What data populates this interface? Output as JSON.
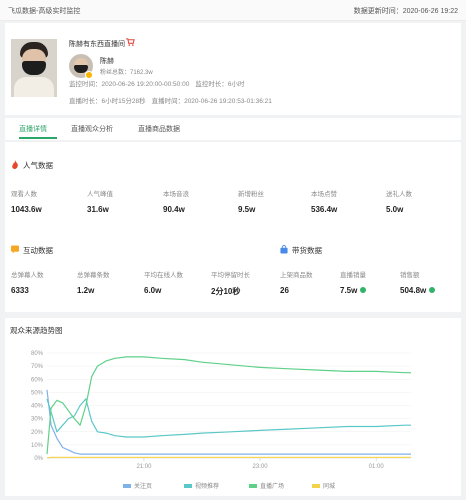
{
  "topbar": {
    "title": "飞瓜数据-高级实时监控",
    "update_time": "数据更新时间：2020-06-26 19:22"
  },
  "profile": {
    "room_title": "陈赫有东西直播间",
    "anchor_name": "陈赫",
    "fans": "粉丝总数：7162.3w",
    "monitor_time_label": "监控时间：",
    "monitor_time": "2020-06-26 19:20:00-00:50:00",
    "monitor_duration": "监控时长：6小时",
    "live_time_label": "直播时长：",
    "live_duration": "6小时15分28秒",
    "live_time_label2": "直播时间：",
    "live_time": "2020-06-26 19:20:53-01:36:21"
  },
  "tabs": [
    {
      "label": "直播详情",
      "active": true
    },
    {
      "label": "直播观众分析",
      "active": false
    },
    {
      "label": "直播商品数据",
      "active": false
    }
  ],
  "popularity": {
    "title": "人气数据",
    "icon": "fire-icon",
    "items": [
      {
        "label": "观看人数",
        "value": "1043.6w"
      },
      {
        "label": "人气峰值",
        "value": "31.6w"
      },
      {
        "label": "本场音浪",
        "value": "90.4w"
      },
      {
        "label": "新增粉丝",
        "value": "9.5w"
      },
      {
        "label": "本场点赞",
        "value": "536.4w"
      },
      {
        "label": "送礼人数",
        "value": "5.0w"
      }
    ]
  },
  "interaction": {
    "title": "互动数据",
    "icon": "chat-icon",
    "items": [
      {
        "label": "总弹幕人数",
        "value": "6333"
      },
      {
        "label": "总弹幕条数",
        "value": "1.2w"
      },
      {
        "label": "平均在线人数",
        "value": "6.0w"
      },
      {
        "label": "平均停留时长",
        "value": "2分10秒"
      }
    ]
  },
  "goods": {
    "title": "带货数据",
    "icon": "shopping-bag-icon",
    "items": [
      {
        "label": "上架商品数",
        "value": "26",
        "check": false
      },
      {
        "label": "直播销量",
        "value": "7.5w",
        "check": true
      },
      {
        "label": "销售额",
        "value": "504.8w",
        "check": true
      }
    ]
  },
  "chart_title": "观众来源趋势图",
  "colors": {
    "accent": "#2da66a",
    "series_guanzhu": "#7fb2e8",
    "series_video": "#5cc7c7",
    "series_plaza": "#5fd08a",
    "series_tongcheng": "#f3d34a"
  },
  "chart_data": {
    "type": "line",
    "title": "观众来源趋势图",
    "ylim": [
      0,
      80
    ],
    "y_ticks": [
      "0%",
      "10%",
      "20%",
      "30%",
      "40%",
      "50%",
      "60%",
      "70%",
      "80%"
    ],
    "x_tick_labels": [
      "21:00",
      "23:00",
      "01:00"
    ],
    "x_hours": [
      19.33,
      19.4,
      19.5,
      19.6,
      19.7,
      19.8,
      19.9,
      20.0,
      20.1,
      20.2,
      20.35,
      20.5,
      20.7,
      21.0,
      21.3,
      21.7,
      22.0,
      22.5,
      23.0,
      23.5,
      24.0,
      24.5,
      25.0,
      25.5,
      25.6
    ],
    "legend_position": "bottom",
    "series": [
      {
        "name": "关注页",
        "values": [
          52,
          25,
          15,
          8,
          6,
          4,
          3,
          3,
          3,
          3,
          3,
          3,
          3,
          3,
          3,
          3,
          3,
          3,
          3,
          3,
          3,
          3,
          3,
          3,
          3
        ]
      },
      {
        "name": "视频推荐",
        "values": [
          45,
          35,
          20,
          25,
          30,
          32,
          40,
          45,
          28,
          20,
          19,
          17,
          16,
          16,
          17,
          18,
          19,
          20,
          21,
          22,
          23,
          24,
          24,
          25,
          25
        ]
      },
      {
        "name": "直播广场",
        "values": [
          3,
          38,
          44,
          42,
          36,
          30,
          25,
          40,
          62,
          70,
          74,
          76,
          77,
          77,
          76,
          75,
          73,
          71,
          69,
          68,
          67,
          66,
          66,
          65,
          65
        ]
      },
      {
        "name": "同城",
        "values": [
          0,
          0.5,
          0.5,
          0.5,
          0.5,
          0.5,
          0.5,
          0.5,
          0.5,
          0.5,
          0.5,
          0.5,
          0.5,
          0.5,
          0.5,
          0.5,
          0.5,
          0.5,
          0.5,
          0.5,
          0.5,
          0.5,
          0.5,
          0.5,
          0.5
        ]
      }
    ]
  }
}
